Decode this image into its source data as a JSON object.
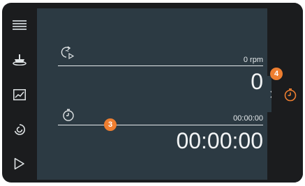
{
  "sidebar": {
    "items": [
      {
        "icon": "menu-icon"
      },
      {
        "icon": "stirrer-icon"
      },
      {
        "icon": "graph-icon"
      },
      {
        "icon": "rotation-icon"
      },
      {
        "icon": "play-icon"
      }
    ]
  },
  "speed": {
    "icon": "speed-play-icon",
    "setpoint": "0 rpm",
    "value": "0"
  },
  "timer": {
    "icon": "timer-icon",
    "setpoint": "00:00:00",
    "value": "00:00:00"
  },
  "callouts": {
    "timer_setpoint": "3",
    "timer_panel": "4"
  },
  "right_panel": {
    "tab_icon": "chevron-right-icon",
    "timer_icon": "timer-icon"
  },
  "colors": {
    "background": "#1b1c1e",
    "panel": "#2c3a43",
    "accent": "#ee7e30",
    "text": "#e6eaec"
  }
}
